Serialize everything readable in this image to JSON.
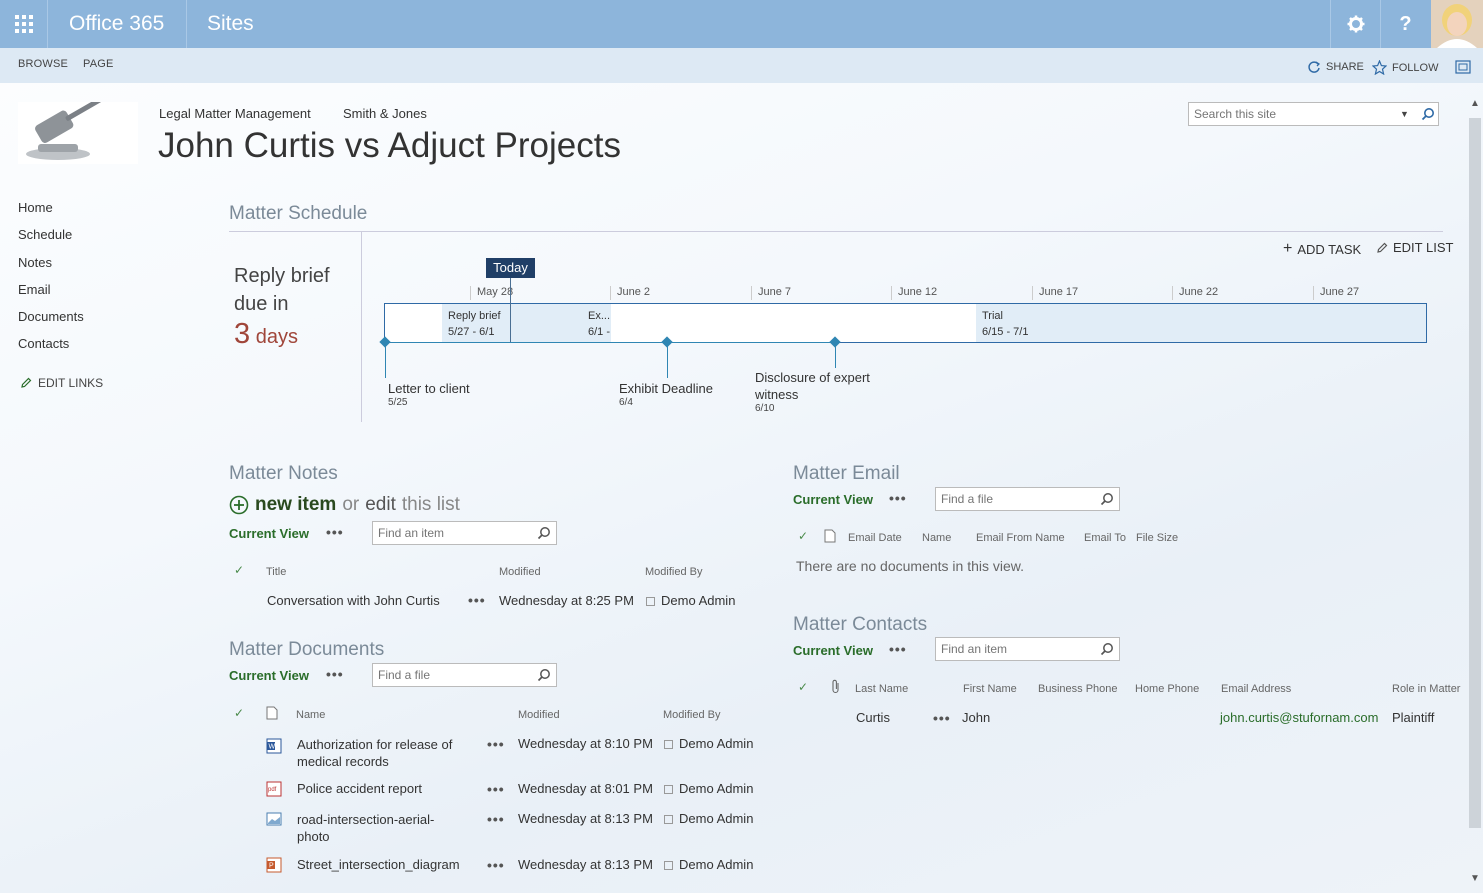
{
  "suite": {
    "brand": "Office 365",
    "app": "Sites",
    "help": "?"
  },
  "ribbon": {
    "tabs": [
      "BROWSE",
      "PAGE"
    ],
    "share": "SHARE",
    "follow": "FOLLOW"
  },
  "header": {
    "breadcrumbs": [
      "Legal Matter Management",
      "Smith & Jones"
    ],
    "title": "John Curtis vs Adjuct Projects",
    "search_placeholder": "Search this site"
  },
  "nav": {
    "items": [
      "Home",
      "Schedule",
      "Notes",
      "Email",
      "Documents",
      "Contacts"
    ],
    "edit_links": "EDIT LINKS"
  },
  "schedule": {
    "title": "Matter Schedule",
    "add_task": "ADD TASK",
    "edit_list": "EDIT LIST",
    "countdown": {
      "line1": "Reply brief",
      "line2": "due in",
      "number": "3",
      "unit": "days"
    },
    "today": "Today",
    "dates": [
      "May 28",
      "June 2",
      "June 7",
      "June 12",
      "June 17",
      "June 22",
      "June 27"
    ],
    "tasks": [
      {
        "name": "Reply brief",
        "range": "5/27 - 6/1"
      },
      {
        "name": "Ex...",
        "range": "6/1 -"
      },
      {
        "name": "Trial",
        "range": "6/15 - 7/1"
      }
    ],
    "milestones": [
      {
        "name": "Letter to client",
        "date": "5/25"
      },
      {
        "name": "Exhibit Deadline",
        "date": "6/4"
      },
      {
        "name": "Disclosure of expert witness",
        "date": "6/10"
      }
    ]
  },
  "notes": {
    "title": "Matter Notes",
    "new_item": "new item",
    "or": "or",
    "edit": "edit",
    "this_list": "this list",
    "current_view": "Current View",
    "ellipsis": "•••",
    "find_placeholder": "Find an item",
    "columns": [
      "Title",
      "Modified",
      "Modified By"
    ],
    "rows": [
      {
        "title": "Conversation with John Curtis",
        "modified": "Wednesday at 8:25 PM",
        "by": "Demo Admin"
      }
    ]
  },
  "documents": {
    "title": "Matter Documents",
    "current_view": "Current View",
    "find_placeholder": "Find a file",
    "columns": [
      "Name",
      "Modified",
      "Modified By"
    ],
    "rows": [
      {
        "name": "Authorization for release of medical records",
        "modified": "Wednesday at 8:10 PM",
        "by": "Demo Admin",
        "icon": "word-doc-icon"
      },
      {
        "name": "Police accident report",
        "modified": "Wednesday at 8:01 PM",
        "by": "Demo Admin",
        "icon": "pdf-icon"
      },
      {
        "name": "road-intersection-aerial-photo",
        "modified": "Wednesday at 8:13 PM",
        "by": "Demo Admin",
        "icon": "image-icon"
      },
      {
        "name": "Street_intersection_diagram",
        "modified": "Wednesday at 8:13 PM",
        "by": "Demo Admin",
        "icon": "powerpoint-icon"
      }
    ]
  },
  "email": {
    "title": "Matter Email",
    "current_view": "Current View",
    "find_placeholder": "Find a file",
    "columns": [
      "Email Date",
      "Name",
      "Email From Name",
      "Email To",
      "File Size"
    ],
    "empty": "There are no documents in this view."
  },
  "contacts": {
    "title": "Matter Contacts",
    "current_view": "Current View",
    "find_placeholder": "Find an item",
    "columns": [
      "Last Name",
      "First Name",
      "Business Phone",
      "Home Phone",
      "Email Address",
      "Role in Matter"
    ],
    "rows": [
      {
        "last": "Curtis",
        "first": "John",
        "email": "john.curtis@stufornam.com",
        "role": "Plaintiff"
      }
    ]
  },
  "colors": {
    "suite_bar": "#8db5db",
    "ribbon": "#dde9f4",
    "accent_green": "#2a6d2a",
    "timeline_blue": "#2f86b3",
    "today": "#203f67",
    "countdown": "#a0463a"
  }
}
